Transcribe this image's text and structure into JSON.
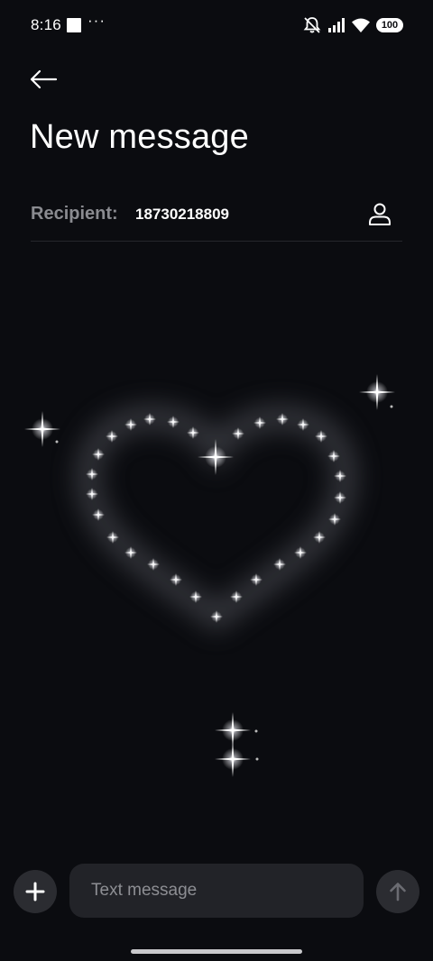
{
  "status_bar": {
    "time": "8:16",
    "more": "···",
    "battery": "100"
  },
  "header": {
    "title": "New message"
  },
  "recipient": {
    "label": "Recipient:",
    "value": "18730218809"
  },
  "composer": {
    "placeholder": "Text message"
  },
  "icons": {
    "back": "back-arrow-icon",
    "contact": "contact-person-icon",
    "add": "plus-icon",
    "send": "send-arrow-icon",
    "mute": "bell-muted-icon",
    "signal": "signal-icon",
    "wifi": "wifi-icon"
  },
  "colors": {
    "background": "#0b0c10",
    "muted_text": "#8a8b90",
    "button_bg": "#2b2c31",
    "input_bg": "#222328"
  }
}
